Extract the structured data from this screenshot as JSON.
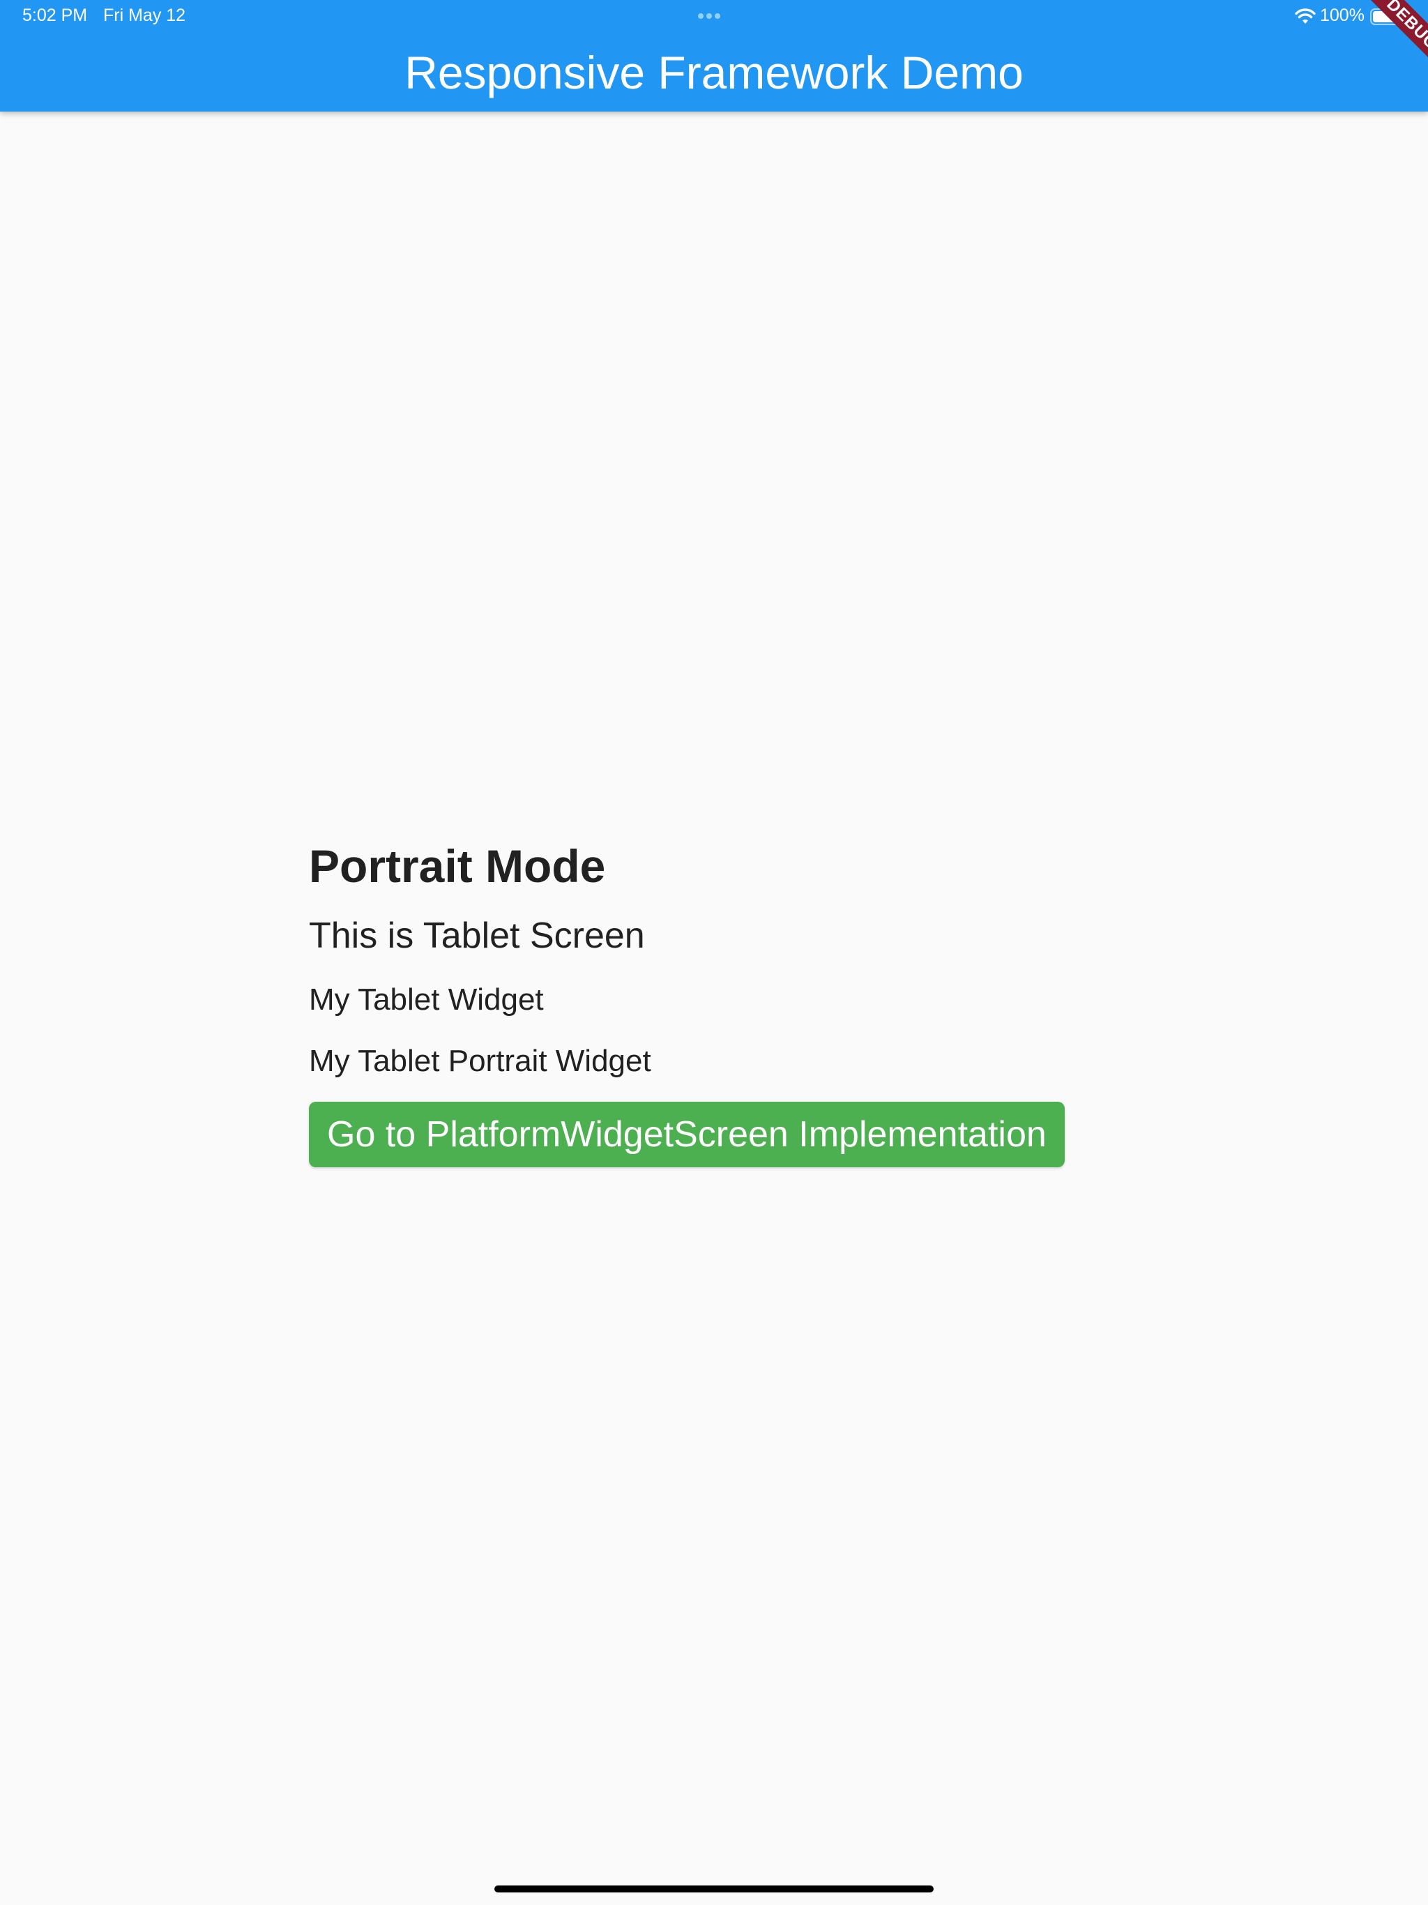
{
  "status_bar": {
    "time": "5:02 PM",
    "date": "Fri May 12",
    "battery": "100%"
  },
  "app_bar": {
    "title": "Responsive Framework Demo",
    "color": "#2196f3"
  },
  "debug_banner": {
    "label": "DEBUG",
    "color": "#8b1a2f"
  },
  "main": {
    "heading": "Portrait Mode",
    "subheading": "This is Tablet Screen",
    "widget_line": "My Tablet Widget",
    "portrait_widget_line": "My Tablet Portrait Widget",
    "button_label": "Go to PlatformWidgetScreen Implementation",
    "button_color": "#4caf50"
  },
  "icons": [
    "wifi-icon",
    "battery-icon",
    "multitasking-dots-icon"
  ]
}
